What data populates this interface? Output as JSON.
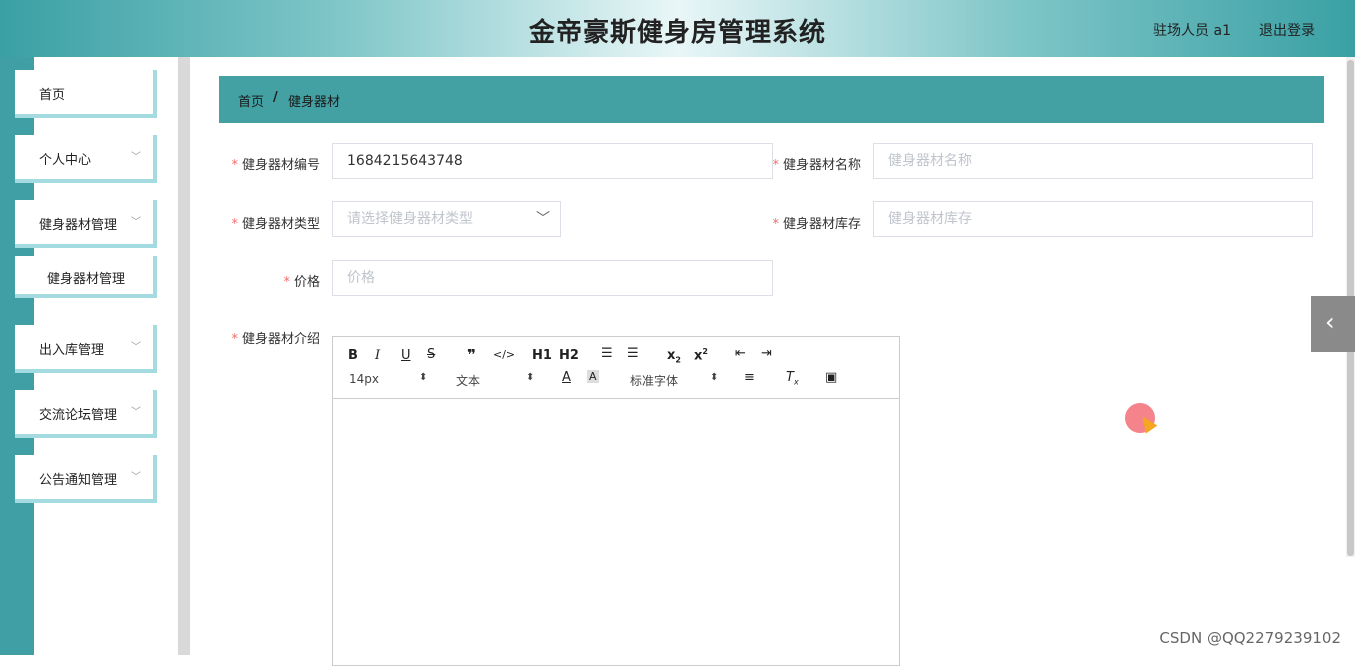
{
  "header": {
    "title": "金帝豪斯健身房管理系统",
    "user": "驻场人员 a1",
    "logout": "退出登录"
  },
  "sidebar": {
    "items": [
      {
        "label": "首页"
      },
      {
        "label": "个人中心"
      },
      {
        "label": "健身器材管理"
      },
      {
        "label": "健身器材管理"
      },
      {
        "label": "出入库管理"
      },
      {
        "label": "交流论坛管理"
      },
      {
        "label": "公告通知管理"
      }
    ]
  },
  "breadcrumb": {
    "home": "首页",
    "separator": "/",
    "current": "健身器材"
  },
  "form": {
    "required_mark": "*",
    "code": {
      "label": "健身器材编号",
      "value": "1684215643748"
    },
    "name": {
      "label": "健身器材名称",
      "placeholder": "健身器材名称"
    },
    "type": {
      "label": "健身器材类型",
      "placeholder": "请选择健身器材类型"
    },
    "stock": {
      "label": "健身器材库存",
      "placeholder": "健身器材库存"
    },
    "price": {
      "label": "价格",
      "placeholder": "价格"
    },
    "intro": {
      "label": "健身器材介绍"
    }
  },
  "editor": {
    "font_size": "14px",
    "text_style": "文本",
    "font_family": "标准字体",
    "h1": "H1",
    "h2": "H2"
  },
  "watermark": "CSDN @QQ2279239102",
  "colors": {
    "accent": "#43a0a3",
    "sidebar": "#3f9fa4",
    "sidebar_border": "#a4dbe0",
    "required": "#f56c6c"
  }
}
